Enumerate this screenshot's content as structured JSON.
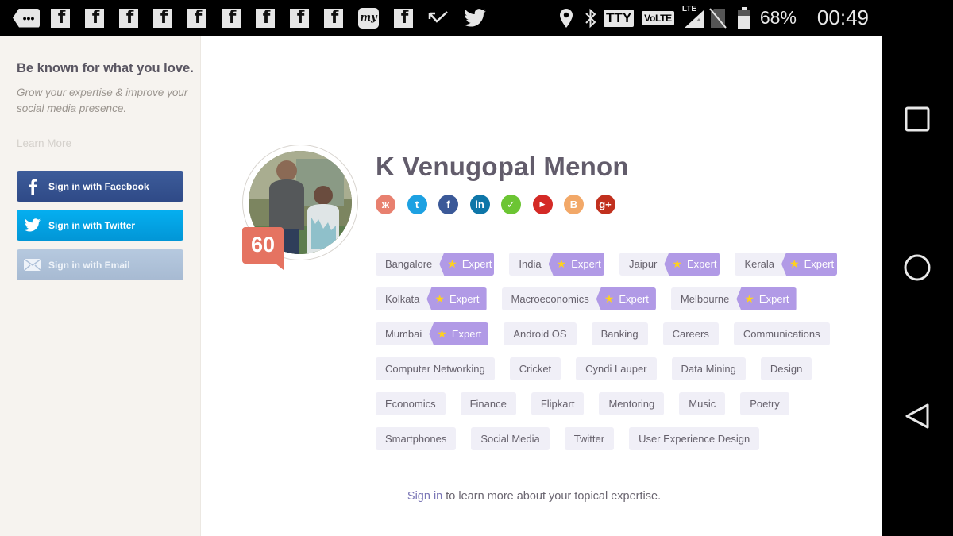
{
  "status_bar": {
    "notification_icons": [
      "more-notifications-icon",
      "facebook-icon",
      "facebook-icon",
      "facebook-icon",
      "facebook-icon",
      "facebook-icon",
      "facebook-icon",
      "facebook-icon",
      "facebook-icon",
      "facebook-icon",
      "mytaxi-icon",
      "facebook-icon",
      "missed-call-icon",
      "twitter-icon"
    ],
    "my_icon_text": "my",
    "fb_glyph": "f",
    "more_glyph": "•••",
    "tty_label": "TTY",
    "volte_label": "VoLTE",
    "lte_label": "LTE",
    "battery_percent": "68%",
    "time": "00:49"
  },
  "sidebar": {
    "title": "Be known for what you love.",
    "subtitle": "Grow your expertise & improve your social media presence.",
    "learn_more": "Learn More",
    "buttons": [
      {
        "label": "Sign in with Facebook",
        "icon": "facebook-icon",
        "color": "#35528f"
      },
      {
        "label": "Sign in with Twitter",
        "icon": "twitter-icon",
        "color": "#03a3e3"
      },
      {
        "label": "Sign in with Email",
        "icon": "envelope-icon",
        "color": "#adc0d8"
      }
    ]
  },
  "profile": {
    "name": "K Venugopal Menon",
    "score": "60",
    "score_color": "#e57361",
    "social_links": [
      {
        "name": "klout",
        "glyph": "ж",
        "color": "#e8806f"
      },
      {
        "name": "twitter",
        "glyph": "t",
        "color": "#1da1e2"
      },
      {
        "name": "facebook",
        "glyph": "f",
        "color": "#3b5998"
      },
      {
        "name": "linkedin",
        "glyph": "in",
        "color": "#0e76a8"
      },
      {
        "name": "feedly",
        "glyph": "✓",
        "color": "#6cc533"
      },
      {
        "name": "youtube",
        "glyph": "▶",
        "color": "#d42a26"
      },
      {
        "name": "blogger",
        "glyph": "B",
        "color": "#f2a868"
      },
      {
        "name": "google-plus",
        "glyph": "g+",
        "color": "#c1301e"
      }
    ],
    "expert_label": "Expert",
    "expert_color": "#b19ae6",
    "tag_rows": [
      [
        {
          "label": "Bangalore",
          "expert": true
        },
        {
          "label": "India",
          "expert": true
        },
        {
          "label": "Jaipur",
          "expert": true
        },
        {
          "label": "Kerala",
          "expert": true
        }
      ],
      [
        {
          "label": "Kolkata",
          "expert": true
        },
        {
          "label": "Macroeconomics",
          "expert": true
        },
        {
          "label": "Melbourne",
          "expert": true
        }
      ],
      [
        {
          "label": "Mumbai",
          "expert": true
        },
        {
          "label": "Android OS",
          "expert": false
        },
        {
          "label": "Banking",
          "expert": false
        },
        {
          "label": "Careers",
          "expert": false
        },
        {
          "label": "Communications",
          "expert": false
        }
      ],
      [
        {
          "label": "Computer Networking",
          "expert": false
        },
        {
          "label": "Cricket",
          "expert": false
        },
        {
          "label": "Cyndi Lauper",
          "expert": false
        },
        {
          "label": "Data Mining",
          "expert": false
        },
        {
          "label": "Design",
          "expert": false
        }
      ],
      [
        {
          "label": "Economics",
          "expert": false
        },
        {
          "label": "Finance",
          "expert": false
        },
        {
          "label": "Flipkart",
          "expert": false
        },
        {
          "label": "Mentoring",
          "expert": false
        },
        {
          "label": "Music",
          "expert": false
        },
        {
          "label": "Poetry",
          "expert": false
        }
      ],
      [
        {
          "label": "Smartphones",
          "expert": false
        },
        {
          "label": "Social Media",
          "expert": false
        },
        {
          "label": "Twitter",
          "expert": false
        },
        {
          "label": "User Experience Design",
          "expert": false
        }
      ]
    ]
  },
  "footer": {
    "signin_link": "Sign in",
    "rest": " to learn more about your topical expertise."
  },
  "nav_bar": {
    "buttons": [
      "recents-button",
      "home-button",
      "back-button"
    ]
  }
}
